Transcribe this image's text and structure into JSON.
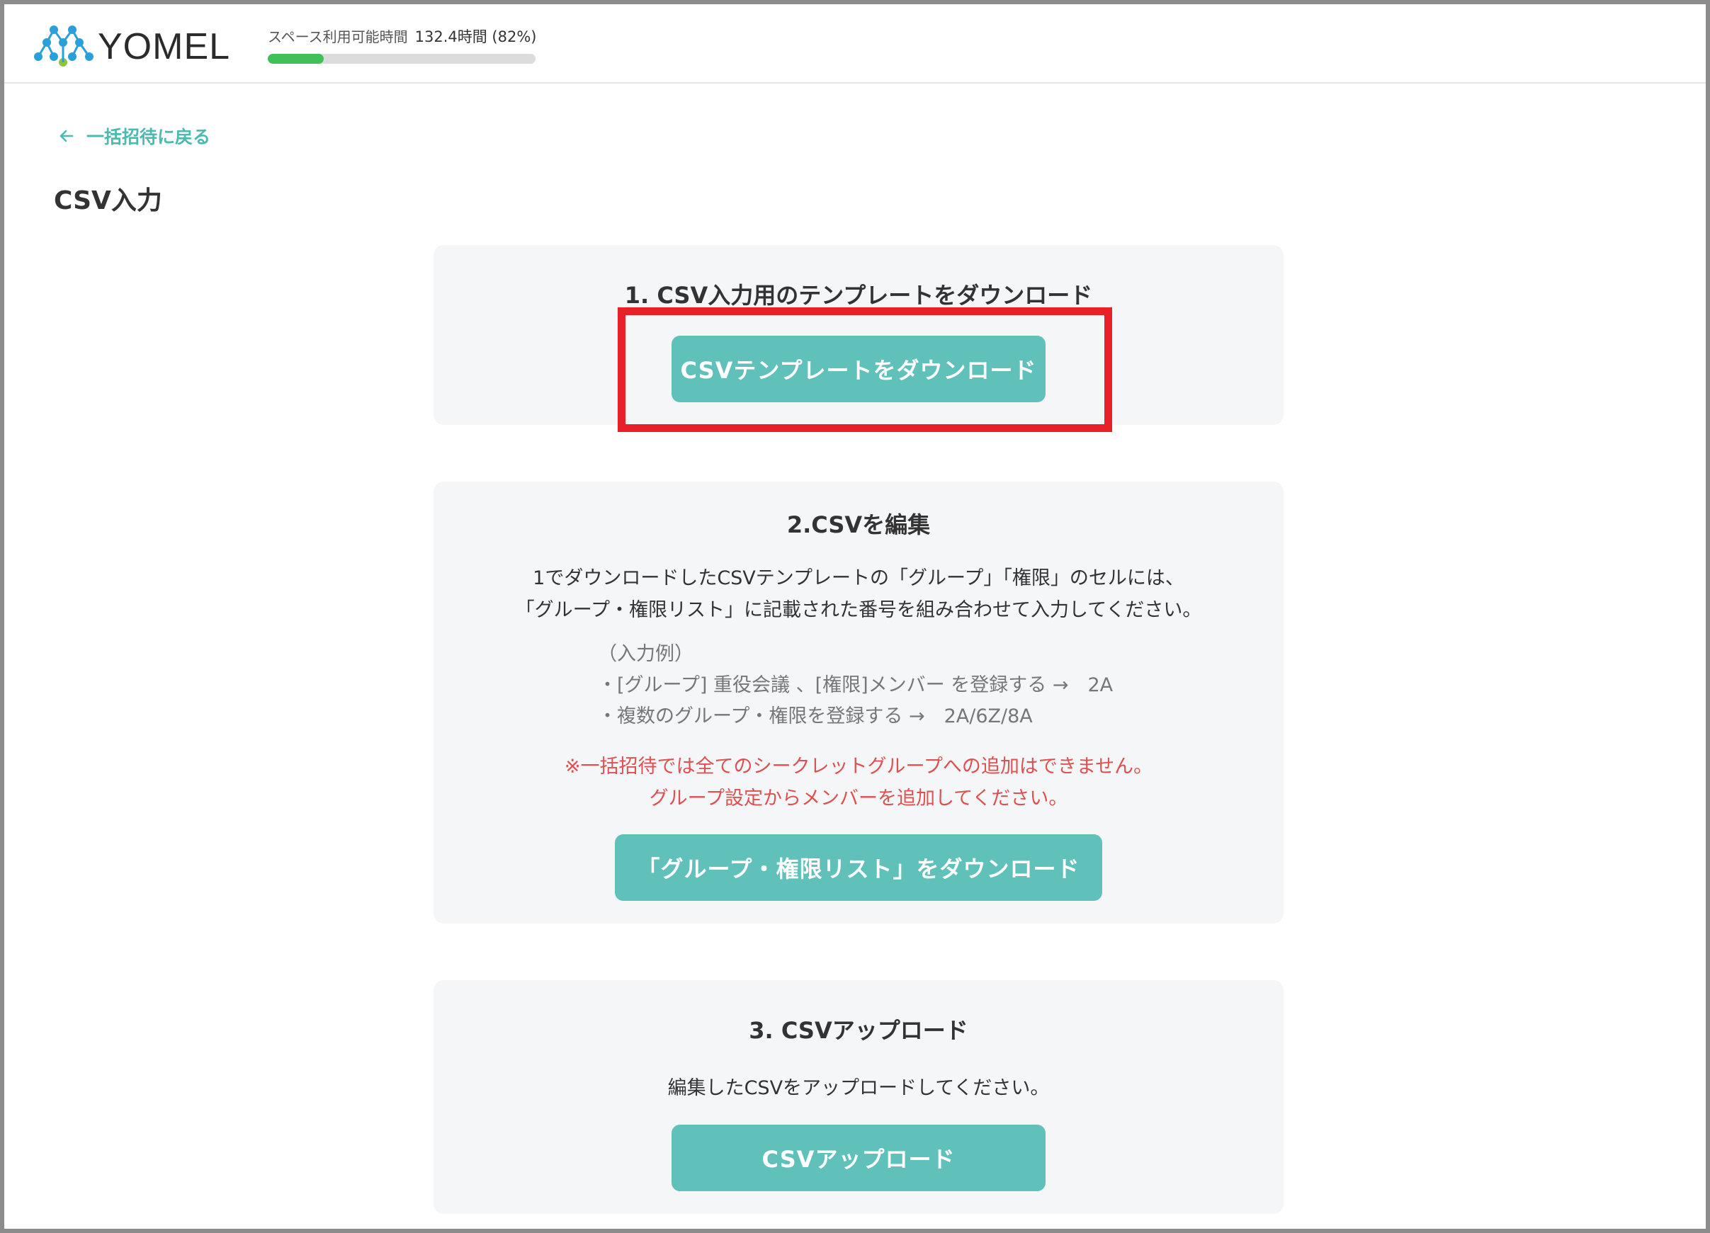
{
  "header": {
    "logo_text": "YOMEL",
    "usage_label": "スペース利用可能時間",
    "usage_value": "132.4時間 (82%)",
    "usage_bar_fraction": 0.21,
    "usage_bar_color": "#41c05a"
  },
  "nav": {
    "back_label": "一括招待に戻る"
  },
  "page": {
    "title": "CSV入力"
  },
  "step1": {
    "title": "1. CSV入力用のテンプレートをダウンロード",
    "button_label": "CSVテンプレートをダウンロード"
  },
  "step2": {
    "title": "2.CSVを編集",
    "desc_line1": "1でダウンロードしたCSVテンプレートの「グループ」「権限」のセルには、",
    "desc_line2": "「グループ・権限リスト」に記載された番号を組み合わせて入力してください。",
    "example_heading": "（入力例）",
    "example_line1": "・[グループ] 重役会議 、[権限]メンバー を登録する →　2A",
    "example_line2": "・複数のグループ・権限を登録する →　2A/6Z/8A",
    "warning_line1": "※一括招待では全てのシークレットグループへの追加はできません。",
    "warning_line2": "グループ設定からメンバーを追加してください。",
    "button_label": "「グループ・権限リスト」をダウンロード"
  },
  "step3": {
    "title": "3. CSVアップロード",
    "desc": "編集したCSVをアップロードしてください。",
    "button_label": "CSVアップロード"
  },
  "colors": {
    "accent": "#5fc1ba",
    "link": "#4dbab0",
    "warning": "#e05050",
    "highlight": "#e8202a"
  }
}
